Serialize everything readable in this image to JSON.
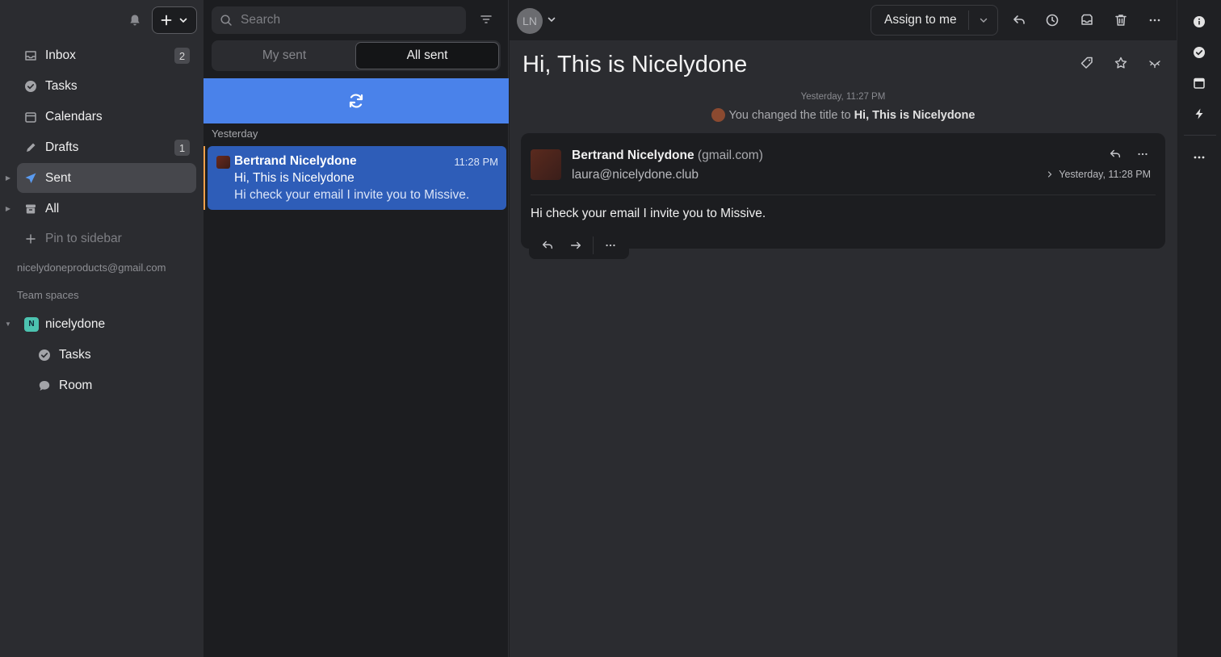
{
  "sidebar": {
    "items": [
      {
        "label": "Inbox",
        "badge": "2",
        "icon": "inbox-icon"
      },
      {
        "label": "Tasks",
        "icon": "check-circle-icon"
      },
      {
        "label": "Calendars",
        "icon": "calendar-icon"
      },
      {
        "label": "Drafts",
        "badge": "1",
        "icon": "pencil-icon"
      },
      {
        "label": "Sent",
        "icon": "paper-plane-icon",
        "active": true
      },
      {
        "label": "All",
        "icon": "archive-icon"
      },
      {
        "label": "Pin to sidebar",
        "icon": "plus-icon"
      }
    ],
    "account_email": "nicelydoneproducts@gmail.com",
    "team_spaces_label": "Team spaces",
    "team": {
      "name": "nicelydone",
      "avatar_letter": "N",
      "children": [
        {
          "label": "Tasks",
          "icon": "check-circle-icon"
        },
        {
          "label": "Room",
          "icon": "chat-bubble-icon"
        }
      ]
    }
  },
  "list": {
    "search_placeholder": "Search",
    "tabs": [
      {
        "label": "My sent",
        "selected": false
      },
      {
        "label": "All sent",
        "selected": true
      }
    ],
    "group_label": "Yesterday",
    "messages": [
      {
        "from": "Bertrand Nicelydone",
        "time": "11:28 PM",
        "subject": "Hi, This is Nicelydone",
        "preview": "Hi check your email I invite you to Missive."
      }
    ]
  },
  "conversation": {
    "avatar_initials": "LN",
    "assign_label": "Assign to me",
    "title": "Hi, This is Nicelydone",
    "event": {
      "time": "Yesterday, 11:27 PM",
      "text_prefix": "You changed the title to",
      "text_value": "Hi, This is Nicelydone"
    },
    "message": {
      "sender_name": "Bertrand Nicelydone",
      "sender_domain": "(gmail.com)",
      "address": "laura@nicelydone.club",
      "time": "Yesterday, 11:28 PM",
      "body": "Hi check your email I invite you to Missive."
    }
  },
  "colors": {
    "accent": "#4a82ea",
    "selected_row": "#2e5db8",
    "team_avatar": "#4cc3b0",
    "unread_marker": "#f0a04a"
  }
}
